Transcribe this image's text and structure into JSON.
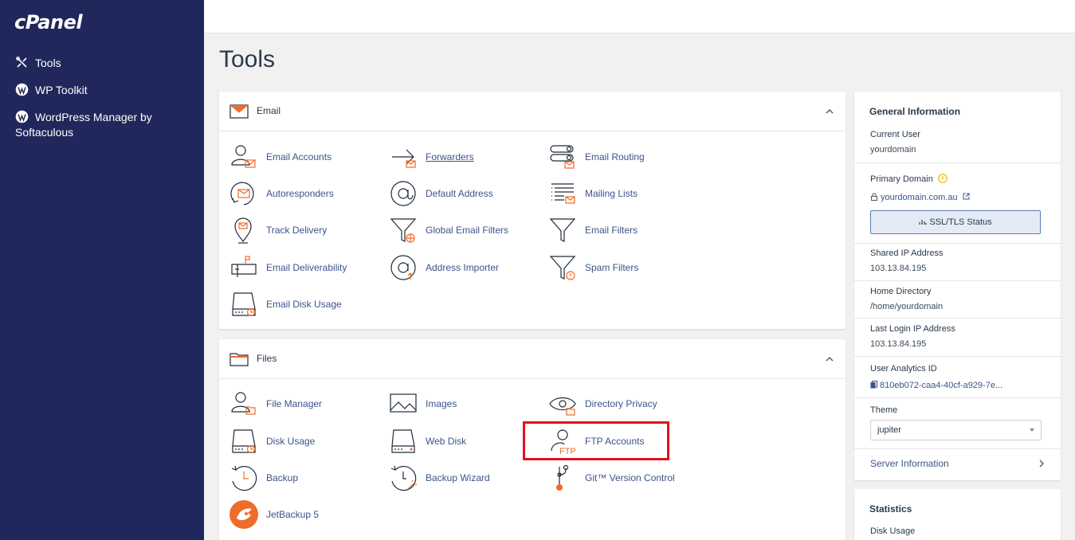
{
  "sidebar": {
    "logo": "cPanel",
    "items": [
      {
        "label": "Tools",
        "icon": "tools-icon"
      },
      {
        "label": "WP Toolkit",
        "icon": "wordpress-icon"
      },
      {
        "label": "WordPress Manager by Softaculous",
        "icon": "wordpress-icon"
      }
    ]
  },
  "page": {
    "title": "Tools"
  },
  "email_section": {
    "title": "Email",
    "tools": [
      {
        "label": "Email Accounts",
        "icon": "email-accounts-icon"
      },
      {
        "label": "Forwarders",
        "icon": "forwarders-icon"
      },
      {
        "label": "Email Routing",
        "icon": "email-routing-icon"
      },
      {
        "label": "Autoresponders",
        "icon": "autoresponders-icon"
      },
      {
        "label": "Default Address",
        "icon": "default-address-icon"
      },
      {
        "label": "Mailing Lists",
        "icon": "mailing-lists-icon"
      },
      {
        "label": "Track Delivery",
        "icon": "track-delivery-icon"
      },
      {
        "label": "Global Email Filters",
        "icon": "global-email-filters-icon"
      },
      {
        "label": "Email Filters",
        "icon": "email-filters-icon"
      },
      {
        "label": "Email Deliverability",
        "icon": "email-deliverability-icon"
      },
      {
        "label": "Address Importer",
        "icon": "address-importer-icon"
      },
      {
        "label": "Spam Filters",
        "icon": "spam-filters-icon"
      },
      {
        "label": "Email Disk Usage",
        "icon": "email-disk-usage-icon"
      }
    ]
  },
  "files_section": {
    "title": "Files",
    "tools": [
      {
        "label": "File Manager",
        "icon": "file-manager-icon"
      },
      {
        "label": "Images",
        "icon": "images-icon"
      },
      {
        "label": "Directory Privacy",
        "icon": "directory-privacy-icon"
      },
      {
        "label": "Disk Usage",
        "icon": "disk-usage-icon"
      },
      {
        "label": "Web Disk",
        "icon": "web-disk-icon"
      },
      {
        "label": "FTP Accounts",
        "icon": "ftp-accounts-icon"
      },
      {
        "label": "Backup",
        "icon": "backup-icon"
      },
      {
        "label": "Backup Wizard",
        "icon": "backup-wizard-icon"
      },
      {
        "label": "Git™ Version Control",
        "icon": "git-icon"
      },
      {
        "label": "JetBackup 5",
        "icon": "jetbackup-icon"
      }
    ],
    "ftp_icon_text": "FTP"
  },
  "general_info": {
    "title": "General Information",
    "current_user_label": "Current User",
    "current_user": "yourdomain",
    "primary_domain_label": "Primary Domain",
    "primary_domain": "yourdomain.com.au",
    "ssl_button": "SSL/TLS Status",
    "shared_ip_label": "Shared IP Address",
    "shared_ip": "103.13.84.195",
    "home_dir_label": "Home Directory",
    "home_dir": "/home/yourdomain",
    "last_login_label": "Last Login IP Address",
    "last_login_ip": "103.13.84.195",
    "analytics_label": "User Analytics ID",
    "analytics_id": "810eb072-caa4-40cf-a929-7e...",
    "theme_label": "Theme",
    "theme_value": "jupiter",
    "server_info": "Server Information"
  },
  "statistics": {
    "title": "Statistics",
    "disk_usage": "Disk Usage"
  },
  "colors": {
    "sidebar_bg": "#20275a",
    "accent_orange": "#ef6c2a",
    "link_blue": "#3b5489",
    "highlight_red": "#e0121c"
  }
}
